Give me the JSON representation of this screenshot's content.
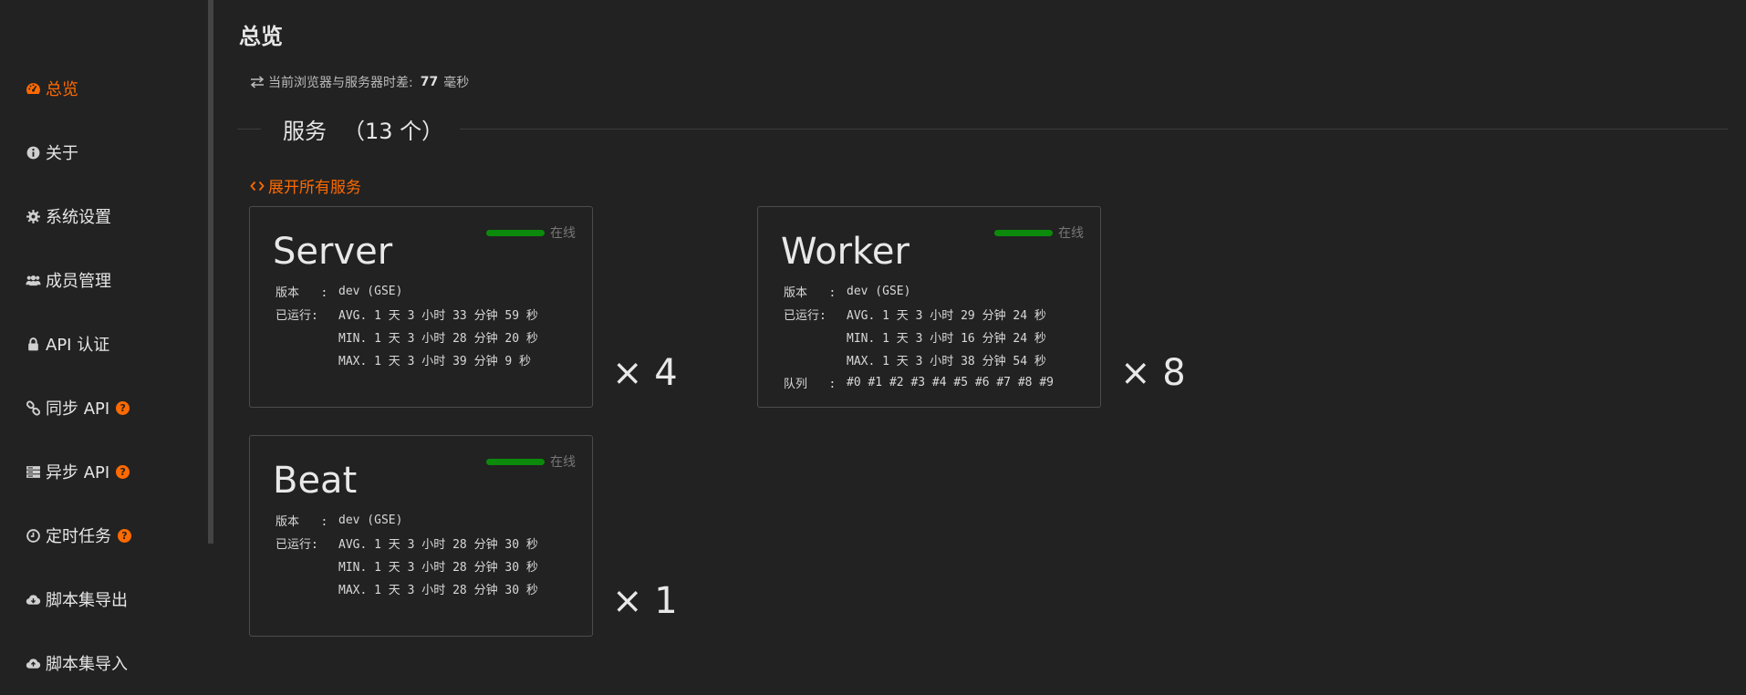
{
  "sidebar": {
    "items": [
      {
        "label": "总览",
        "icon": "dashboard-icon",
        "active": true,
        "help": false
      },
      {
        "label": "关于",
        "icon": "info-icon",
        "active": false,
        "help": false
      },
      {
        "label": "系统设置",
        "icon": "gear-icon",
        "active": false,
        "help": false
      },
      {
        "label": "成员管理",
        "icon": "users-icon",
        "active": false,
        "help": false
      },
      {
        "label": "API 认证",
        "icon": "lock-icon",
        "active": false,
        "help": false
      },
      {
        "label": "同步 API",
        "icon": "link-icon",
        "active": false,
        "help": true
      },
      {
        "label": "异步 API",
        "icon": "server-icon",
        "active": false,
        "help": true
      },
      {
        "label": "定时任务",
        "icon": "clock-icon",
        "active": false,
        "help": true
      },
      {
        "label": "脚本集导出",
        "icon": "cloud-download-icon",
        "active": false,
        "help": false
      },
      {
        "label": "脚本集导入",
        "icon": "cloud-upload-icon",
        "active": false,
        "help": false
      }
    ],
    "help_glyph": "?"
  },
  "main": {
    "title": "总览",
    "time_diff": {
      "label": "当前浏览器与服务器时差:",
      "value": "77",
      "unit": "毫秒"
    },
    "section": {
      "title": "服务",
      "count": "（13 个）"
    },
    "expand_label": "展开所有服务",
    "status_online": "在线",
    "labels": {
      "version": "版本",
      "uptime": "已运行",
      "queue": "队列",
      "colon": ":"
    },
    "services": [
      {
        "name": "Server",
        "version": "dev (GSE)",
        "avg": "AVG. 1 天 3 小时 33 分钟 59 秒",
        "min": "MIN. 1 天 3 小时 28 分钟 20 秒",
        "max": "MAX. 1 天 3 小时 39 分钟 9 秒",
        "queues": "",
        "multiplier": "× 4"
      },
      {
        "name": "Worker",
        "version": "dev (GSE)",
        "avg": "AVG. 1 天 3 小时 29 分钟 24 秒",
        "min": "MIN. 1 天 3 小时 16 分钟 24 秒",
        "max": "MAX. 1 天 3 小时 38 分钟 54 秒",
        "queues": "#0 #1 #2 #3 #4 #5 #6 #7 #8 #9",
        "multiplier": "× 8"
      },
      {
        "name": "Beat",
        "version": "dev (GSE)",
        "avg": "AVG. 1 天 3 小时 28 分钟 30 秒",
        "min": "MIN. 1 天 3 小时 28 分钟 30 秒",
        "max": "MAX. 1 天 3 小时 28 分钟 30 秒",
        "queues": "",
        "multiplier": "× 1"
      }
    ]
  },
  "colors": {
    "accent": "#ff6a00",
    "online": "#0b8a0b",
    "background": "#222222"
  }
}
